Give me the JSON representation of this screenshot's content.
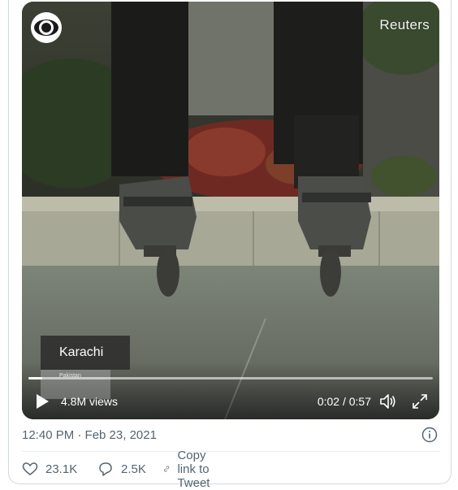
{
  "video": {
    "watermark": "Reuters",
    "location_label": "Karachi",
    "location_sublabel": "Pakistan",
    "views": "4.8M views",
    "time": "0:02 / 0:57",
    "progress_fraction": 0.035
  },
  "tweet": {
    "timestamp": "12:40 PM · Feb 23, 2021"
  },
  "actions": {
    "likes": "23.1K",
    "replies": "2.5K",
    "copy_link": "Copy link to Tweet"
  },
  "icons": {
    "logo": "cbs-eye-logo-icon",
    "play": "play-icon",
    "volume": "volume-icon",
    "fullscreen": "fullscreen-icon",
    "info": "info-icon",
    "like": "heart-icon",
    "reply": "reply-bubble-icon",
    "link": "link-icon"
  },
  "colors": {
    "secondary_text": "#536471",
    "divider": "#e6ecf0",
    "card_border": "#cfd9de"
  }
}
